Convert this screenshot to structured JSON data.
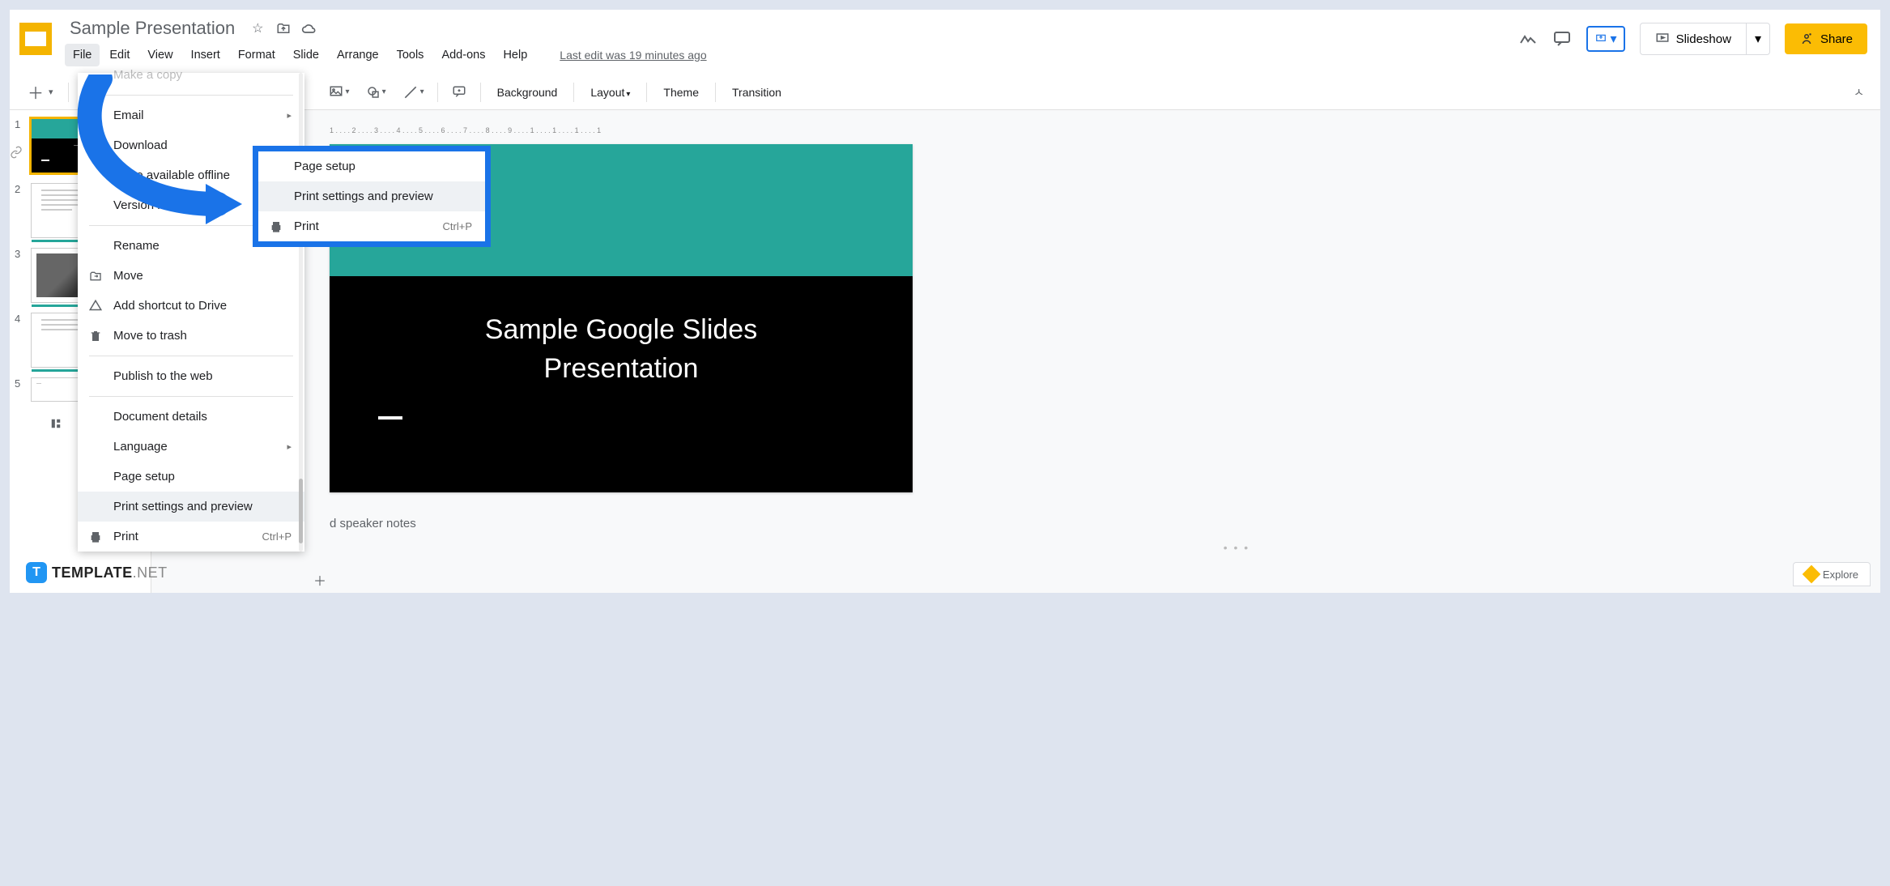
{
  "header": {
    "doc_title": "Sample Presentation",
    "slideshow_label": "Slideshow",
    "share_label": "Share"
  },
  "menubar": {
    "file": "File",
    "edit": "Edit",
    "view": "View",
    "insert": "Insert",
    "format": "Format",
    "slide": "Slide",
    "arrange": "Arrange",
    "tools": "Tools",
    "addons": "Add-ons",
    "help": "Help",
    "last_edit": "Last edit was 19 minutes ago"
  },
  "toolbar": {
    "background": "Background",
    "layout": "Layout",
    "theme": "Theme",
    "transition": "Transition"
  },
  "ruler_marks": "1 . . . . 2 . . . . 3 . . . . 4 . . . . 5 . . . . 6 . . . . 7 . . . . 8 . . . . 9 . . . . 1 . . . . 1 . . . . 1 . . . . 1",
  "slide": {
    "title_line1": "Sample Google Slides",
    "title_line2": "Presentation"
  },
  "speaker_notes_placeholder": "d speaker notes",
  "file_menu": {
    "make_copy": "Make a copy",
    "email": "Email",
    "download": "Download",
    "offline": "Make available offline",
    "version_history": "Version history",
    "rename": "Rename",
    "move": "Move",
    "add_shortcut": "Add shortcut to Drive",
    "move_trash": "Move to trash",
    "publish": "Publish to the web",
    "doc_details": "Document details",
    "language": "Language",
    "page_setup": "Page setup",
    "print_preview": "Print settings and preview",
    "print": "Print",
    "print_shortcut": "Ctrl+P"
  },
  "blue_box": {
    "page_setup": "Page setup",
    "print_preview": "Print settings and preview",
    "print": "Print",
    "print_shortcut": "Ctrl+P"
  },
  "thumbs": [
    "1",
    "2",
    "3",
    "4",
    "5"
  ],
  "explore_label": "Explore",
  "watermark": {
    "badge": "T",
    "text_bold": "TEMPLATE",
    "text_light": ".NET"
  }
}
